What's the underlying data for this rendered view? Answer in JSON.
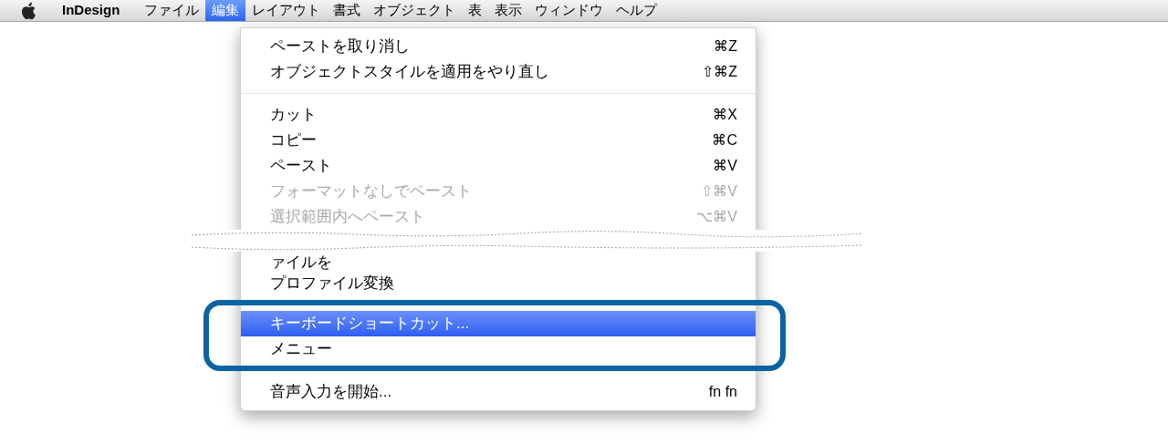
{
  "menu_bar": {
    "app": "InDesign",
    "menus": [
      {
        "label": "ファイル",
        "selected": false
      },
      {
        "label": "編集",
        "selected": true
      },
      {
        "label": "レイアウト",
        "selected": false
      },
      {
        "label": "書式",
        "selected": false
      },
      {
        "label": "オブジェクト",
        "selected": false
      },
      {
        "label": "表",
        "selected": false
      },
      {
        "label": "表示",
        "selected": false
      },
      {
        "label": "ウィンドウ",
        "selected": false
      },
      {
        "label": "ヘルプ",
        "selected": false
      }
    ]
  },
  "menu": {
    "sections": [
      {
        "framed": false,
        "items": [
          {
            "kind": "item",
            "label": "ペーストを取り消し",
            "shortcut": "⌘Z",
            "disabled": false,
            "selected": false
          },
          {
            "kind": "item",
            "label": "オブジェクトスタイルを適用をやり直し",
            "shortcut": "⇧⌘Z",
            "disabled": false,
            "selected": false
          }
        ]
      },
      {
        "framed": false,
        "items": [
          {
            "kind": "item",
            "label": "カット",
            "shortcut": "⌘X",
            "disabled": false,
            "selected": false
          },
          {
            "kind": "item",
            "label": "コピー",
            "shortcut": "⌘C",
            "disabled": false,
            "selected": false
          },
          {
            "kind": "item",
            "label": "ペースト",
            "shortcut": "⌘V",
            "disabled": false,
            "selected": false
          },
          {
            "kind": "item",
            "label": "フォーマットなしでペースト",
            "shortcut": "⇧⌘V",
            "disabled": true,
            "selected": false
          },
          {
            "kind": "item",
            "label": "選択範囲内へペースト",
            "shortcut": "⌥⌘V",
            "disabled": true,
            "selected": false
          },
          {
            "kind": "tear"
          },
          {
            "kind": "item",
            "label": "ァイルを",
            "disabled": false,
            "selected": false
          },
          {
            "kind": "item",
            "label": "プロファイル変換",
            "disabled": false,
            "selected": false
          }
        ]
      },
      {
        "framed": true,
        "items": [
          {
            "kind": "item",
            "label": "キーボードショートカット...",
            "disabled": false,
            "selected": true
          },
          {
            "kind": "item",
            "label": "メニュー",
            "disabled": false,
            "selected": false
          }
        ]
      },
      {
        "framed": false,
        "items": [
          {
            "kind": "item",
            "label": "音声入力を開始...",
            "shortcut": "fn fn",
            "disabled": false,
            "selected": false
          }
        ]
      }
    ]
  }
}
